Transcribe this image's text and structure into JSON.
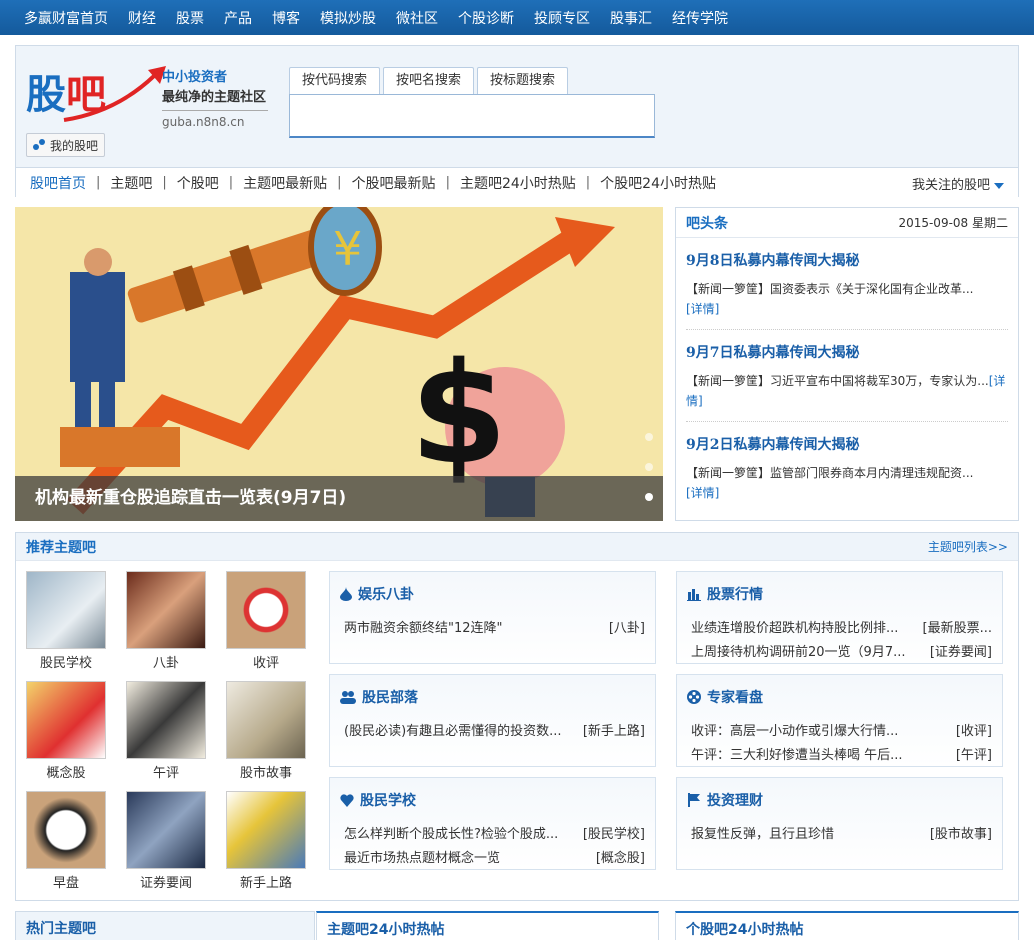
{
  "topnav": [
    "多赢财富首页",
    "财经",
    "股票",
    "产品",
    "博客",
    "模拟炒股",
    "微社区",
    "个股诊断",
    "投顾专区",
    "股事汇",
    "经传学院"
  ],
  "header": {
    "logo_gu": "股",
    "logo_ba": "吧",
    "slogan1": "中小投资者",
    "slogan2": "最纯净的主题社区",
    "domain": "guba.n8n8.cn",
    "my_bar": "我的股吧",
    "search_tabs": [
      "按代码搜索",
      "按吧名搜索",
      "按标题搜索"
    ]
  },
  "subnav": {
    "items": [
      "股吧首页",
      "主题吧",
      "个股吧",
      "主题吧最新贴",
      "个股吧最新贴",
      "主题吧24小时热贴",
      "个股吧24小时热贴"
    ],
    "follow": "我关注的股吧"
  },
  "banner": {
    "caption": "机构最新重仓股追踪直击一览表(9月7日)"
  },
  "headlines": {
    "title": "吧头条",
    "date": "2015-09-08 星期二",
    "items": [
      {
        "title": "9月8日私募内幕传闻大揭秘",
        "desc": "【新闻一箩筐】国资委表示《关于深化国有企业改革...",
        "more": "[详情]"
      },
      {
        "title": "9月7日私募内幕传闻大揭秘",
        "desc": "【新闻一箩筐】习近平宣布中国将裁军30万，专家认为...",
        "more": "[详情]"
      },
      {
        "title": "9月2日私募内幕传闻大揭秘",
        "desc": "【新闻一箩筐】监管部门限券商本月内清理违规配资...",
        "more": "[详情]"
      }
    ]
  },
  "recommend": {
    "title": "推荐主题吧",
    "list_link": "主题吧列表>>",
    "thumbs": [
      "股民学校",
      "八卦",
      "收评",
      "概念股",
      "午评",
      "股市故事",
      "早盘",
      "证券要闻",
      "新手上路"
    ],
    "boxes": [
      {
        "title": "娱乐八卦",
        "icon": "drop-icon",
        "rows": [
          {
            "text": "两市融资余额终结\"12连降\"",
            "tag": "[八卦]"
          }
        ]
      },
      {
        "title": "股票行情",
        "icon": "bar-chart-icon",
        "rows": [
          {
            "text": "业绩连增股价超跌机构持股比例排...",
            "tag": "[最新股票..."
          },
          {
            "text": "上周接待机构调研前20一览（9月7...",
            "tag": "[证券要闻]"
          }
        ]
      },
      {
        "title": "股民部落",
        "icon": "users-icon",
        "rows": [
          {
            "text": "(股民必读)有趣且必需懂得的投资数...",
            "tag": "[新手上路]"
          }
        ]
      },
      {
        "title": "专家看盘",
        "icon": "film-icon",
        "rows": [
          {
            "text": "收评：高层一小动作或引爆大行情...",
            "tag": "[收评]"
          },
          {
            "text": "午评：三大利好惨遭当头棒喝 午后...",
            "tag": "[午评]"
          }
        ]
      },
      {
        "title": "股民学校",
        "icon": "heart-icon",
        "rows": [
          {
            "text": "怎么样判断个股成长性?检验个股成...",
            "tag": "[股民学校]"
          },
          {
            "text": "最近市场热点题材概念一览",
            "tag": "[概念股]"
          }
        ]
      },
      {
        "title": "投资理财",
        "icon": "flag-icon",
        "rows": [
          {
            "text": "报复性反弹，且行且珍惜",
            "tag": "[股市故事]"
          }
        ]
      }
    ]
  },
  "bottom": [
    "热门主题吧",
    "主题吧24小时热帖",
    "个股吧24小时热帖"
  ]
}
